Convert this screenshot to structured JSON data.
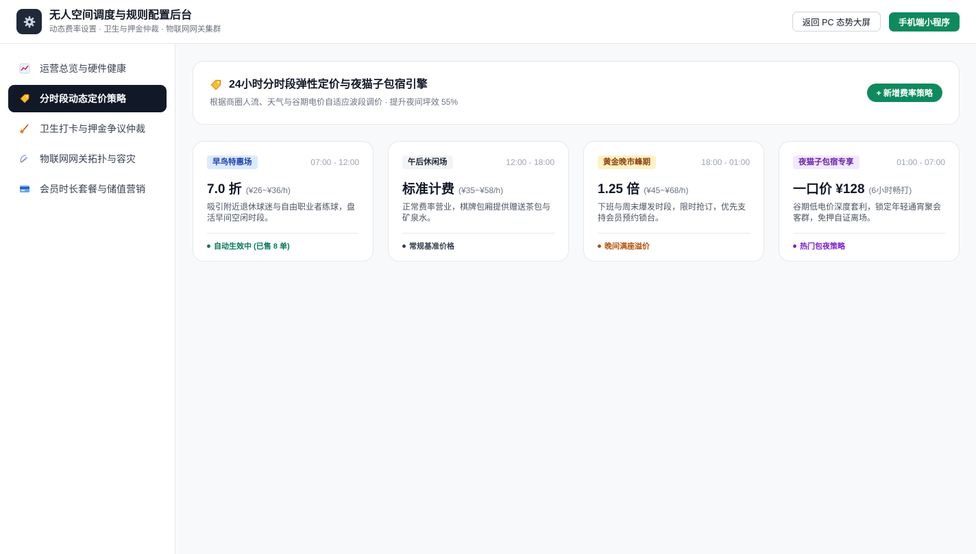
{
  "header": {
    "title": "无人空间调度与规则配置后台",
    "subtitle": "动态费率设置 · 卫生与押金仲裁 · 物联网网关集群",
    "back_label": "返回 PC 态势大屏",
    "mini_program_label": "手机端小程序"
  },
  "sidebar": {
    "items": [
      {
        "label": "运营总览与硬件健康",
        "icon": "chart-icon",
        "active": false
      },
      {
        "label": "分时段动态定价策略",
        "icon": "price-tag-icon",
        "active": true
      },
      {
        "label": "卫生打卡与押金争议仲裁",
        "icon": "broom-icon",
        "active": false
      },
      {
        "label": "物联网网关拓扑与容灾",
        "icon": "satellite-icon",
        "active": false
      },
      {
        "label": "会员时长套餐与储值营销",
        "icon": "card-icon",
        "active": false
      }
    ]
  },
  "banner": {
    "icon": "price-tag-icon",
    "title": "24小时分时段弹性定价与夜猫子包宿引擎",
    "description": "根据商圈人流、天气与谷期电价自适应波段调价 · 提升夜间坪效 55%",
    "add_button_label": "+ 新增费率策略"
  },
  "cards": [
    {
      "tag": "早鸟特惠场",
      "tag_color": "#1e40af",
      "tag_bg": "#dbeafe",
      "time": "07:00 - 12:00",
      "price": "7.0 折",
      "price_note": "(¥26~¥36/h)",
      "description": "吸引附近退休球迷与自由职业者练球，盘活早间空闲时段。",
      "status": "自动生效中 (已售 8 单)",
      "status_color": "#047857"
    },
    {
      "tag": "午后休闲场",
      "tag_color": "#1f2937",
      "tag_bg": "#f3f4f6",
      "time": "12:00 - 18:00",
      "price": "标准计费",
      "price_note": "(¥35~¥58/h)",
      "description": "正常费率营业，棋牌包厢提供赠送茶包与矿泉水。",
      "status": "常规基准价格",
      "status_color": "#374151"
    },
    {
      "tag": "黄金晚市峰期",
      "tag_color": "#92400e",
      "tag_bg": "#fef3c7",
      "time": "18:00 - 01:00",
      "price": "1.25 倍",
      "price_note": "(¥45~¥68/h)",
      "description": "下班与周末爆发时段，限时抢订，优先支持会员预约锁台。",
      "status": "晚间满座溢价",
      "status_color": "#b45309"
    },
    {
      "tag": "夜猫子包宿专享",
      "tag_color": "#6b21a8",
      "tag_bg": "#f3e8ff",
      "time": "01:00 - 07:00",
      "price": "一口价 ¥128",
      "price_note": "(6小时畅打)",
      "description": "谷期低电价深度套利，锁定年轻通宵聚会客群，免押自证离场。",
      "status": "热门包夜策略",
      "status_color": "#7e22ce"
    }
  ]
}
